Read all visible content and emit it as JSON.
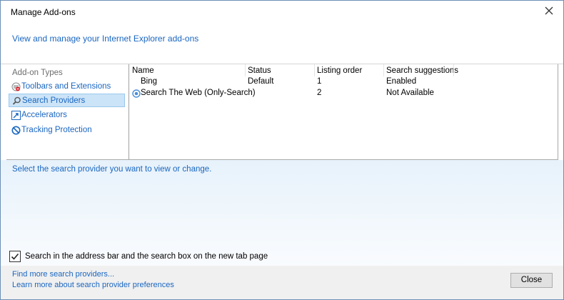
{
  "window": {
    "title": "Manage Add-ons"
  },
  "header": {
    "link_text": "View and manage your Internet Explorer add-ons"
  },
  "sidebar": {
    "title": "Add-on Types",
    "items": [
      {
        "label": "Toolbars and Extensions",
        "icon": "toolbars-icon"
      },
      {
        "label": "Search Providers",
        "icon": "search-icon",
        "selected": true
      },
      {
        "label": "Accelerators",
        "icon": "accelerators-icon"
      },
      {
        "label": "Tracking Protection",
        "icon": "tracking-protection-icon"
      }
    ]
  },
  "list": {
    "columns": [
      "Name",
      "Status",
      "Listing order",
      "Search suggestions"
    ],
    "rows": [
      {
        "name": "Bing",
        "status": "Default",
        "order": "1",
        "suggestions": "Enabled"
      },
      {
        "name": "Search The Web (Only-Search)",
        "status": "",
        "order": "2",
        "suggestions": "Not Available"
      }
    ]
  },
  "details": {
    "hint": "Select the search provider you want to view or change."
  },
  "options": {
    "checkbox_label": "Search in the address bar and the search box on the new tab page",
    "checked": true
  },
  "footer": {
    "link_find": "Find more search providers...",
    "link_learn": "Learn more about search provider preferences",
    "close_label": "Close"
  },
  "colors": {
    "link": "#1a66c0",
    "selection": "#cce4f7",
    "details_bg": "#e7f2fb"
  }
}
